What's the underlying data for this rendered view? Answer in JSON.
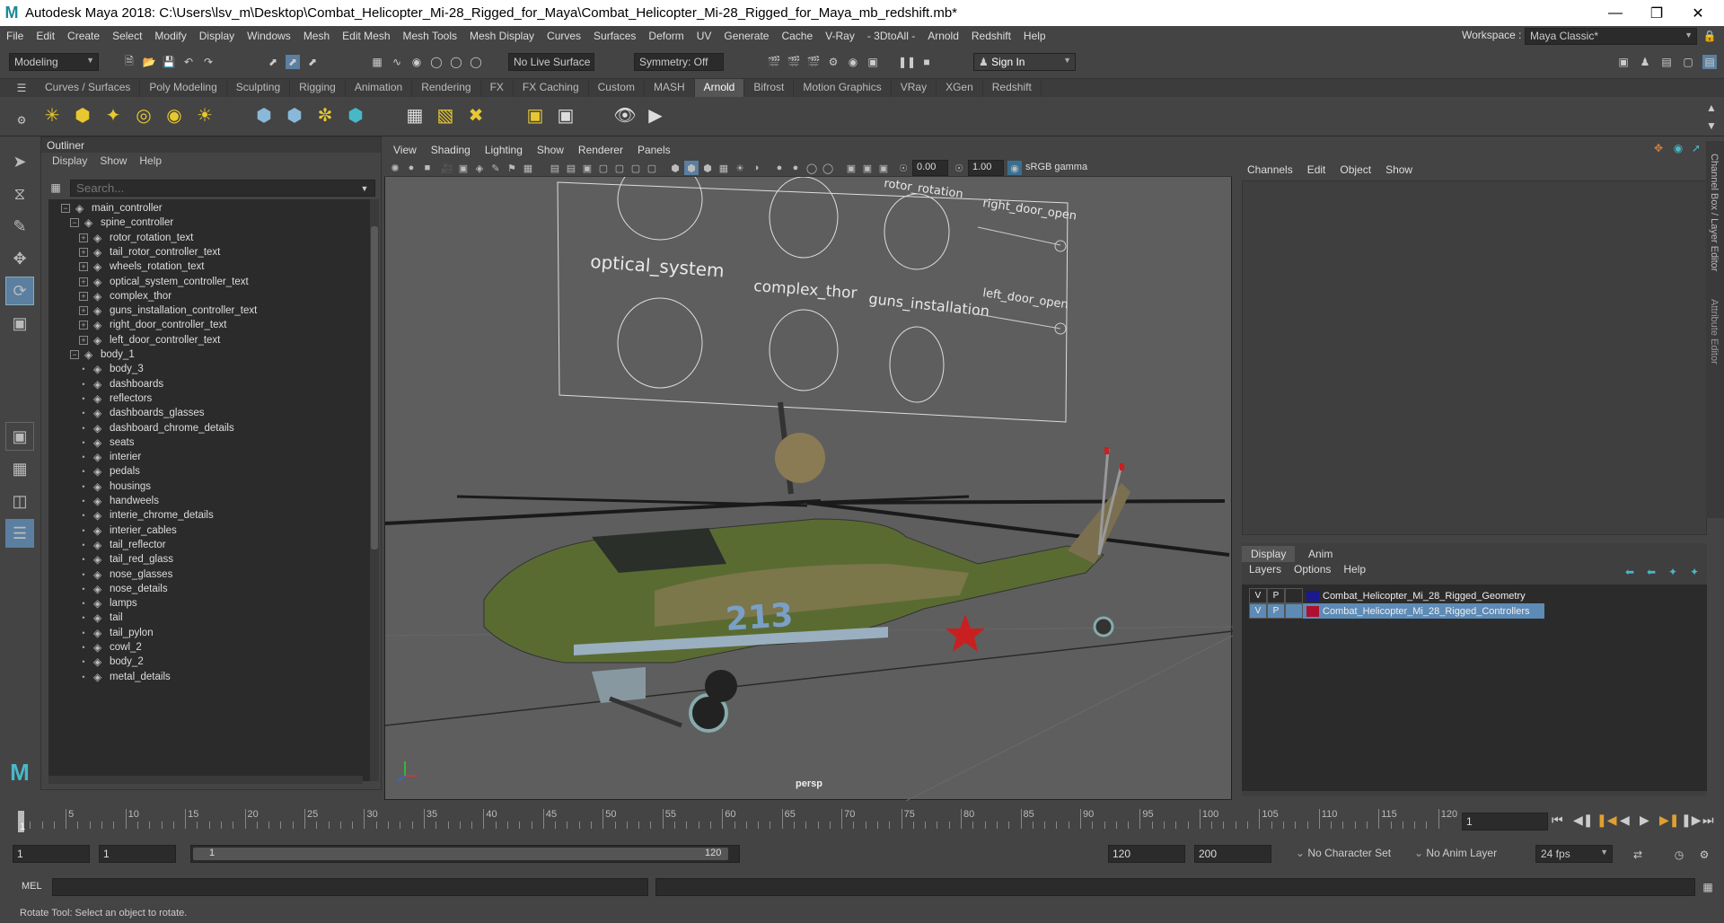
{
  "window": {
    "title": "Autodesk Maya 2018: C:\\Users\\lsv_m\\Desktop\\Combat_Helicopter_Mi-28_Rigged_for_Maya\\Combat_Helicopter_Mi-28_Rigged_for_Maya_mb_redshift.mb*"
  },
  "menubar": [
    "File",
    "Edit",
    "Create",
    "Select",
    "Modify",
    "Display",
    "Windows",
    "Mesh",
    "Edit Mesh",
    "Mesh Tools",
    "Mesh Display",
    "Curves",
    "Surfaces",
    "Deform",
    "UV",
    "Generate",
    "Cache",
    "V-Ray",
    "- 3DtoAll -",
    "Arnold",
    "Redshift",
    "Help"
  ],
  "workspace": {
    "label": "Workspace :",
    "value": "Maya Classic*"
  },
  "statusline": {
    "mode": "Modeling",
    "live_surface": "No Live Surface",
    "symmetry": "Symmetry: Off",
    "sign_in": "Sign In"
  },
  "shelf_tabs": [
    "Curves / Surfaces",
    "Poly Modeling",
    "Sculpting",
    "Rigging",
    "Animation",
    "Rendering",
    "FX",
    "FX Caching",
    "Custom",
    "MASH",
    "Arnold",
    "Bifrost",
    "Motion Graphics",
    "VRay",
    "XGen",
    "Redshift"
  ],
  "shelf_active": "Arnold",
  "outliner": {
    "title": "Outliner",
    "menu": [
      "Display",
      "Show",
      "Help"
    ],
    "search_placeholder": "Search...",
    "items": [
      {
        "label": "main_controller",
        "depth": 0,
        "expander": "minus"
      },
      {
        "label": "spine_controller",
        "depth": 1,
        "expander": "minus"
      },
      {
        "label": "rotor_rotation_text",
        "depth": 2,
        "expander": "plus"
      },
      {
        "label": "tail_rotor_controller_text",
        "depth": 2,
        "expander": "plus"
      },
      {
        "label": "wheels_rotation_text",
        "depth": 2,
        "expander": "plus"
      },
      {
        "label": "optical_system_controller_text",
        "depth": 2,
        "expander": "plus"
      },
      {
        "label": "complex_thor",
        "depth": 2,
        "expander": "plus"
      },
      {
        "label": "guns_installation_controller_text",
        "depth": 2,
        "expander": "plus"
      },
      {
        "label": "right_door_controller_text",
        "depth": 2,
        "expander": "plus"
      },
      {
        "label": "left_door_controller_text",
        "depth": 2,
        "expander": "plus"
      },
      {
        "label": "body_1",
        "depth": 1,
        "expander": "minus"
      },
      {
        "label": "body_3",
        "depth": 2,
        "expander": "dot"
      },
      {
        "label": "dashboards",
        "depth": 2,
        "expander": "dot"
      },
      {
        "label": "reflectors",
        "depth": 2,
        "expander": "dot"
      },
      {
        "label": "dashboards_glasses",
        "depth": 2,
        "expander": "dot"
      },
      {
        "label": "dashboard_chrome_details",
        "depth": 2,
        "expander": "dot"
      },
      {
        "label": "seats",
        "depth": 2,
        "expander": "dot"
      },
      {
        "label": "interier",
        "depth": 2,
        "expander": "dot"
      },
      {
        "label": "pedals",
        "depth": 2,
        "expander": "dot"
      },
      {
        "label": "housings",
        "depth": 2,
        "expander": "dot"
      },
      {
        "label": "handweels",
        "depth": 2,
        "expander": "dot"
      },
      {
        "label": "interie_chrome_details",
        "depth": 2,
        "expander": "dot"
      },
      {
        "label": "interier_cables",
        "depth": 2,
        "expander": "dot"
      },
      {
        "label": "tail_reflector",
        "depth": 2,
        "expander": "dot"
      },
      {
        "label": "tail_red_glass",
        "depth": 2,
        "expander": "dot"
      },
      {
        "label": "nose_glasses",
        "depth": 2,
        "expander": "dot"
      },
      {
        "label": "nose_details",
        "depth": 2,
        "expander": "dot"
      },
      {
        "label": "lamps",
        "depth": 2,
        "expander": "dot"
      },
      {
        "label": "tail",
        "depth": 2,
        "expander": "dot"
      },
      {
        "label": "tail_pylon",
        "depth": 2,
        "expander": "dot"
      },
      {
        "label": "cowl_2",
        "depth": 2,
        "expander": "dot"
      },
      {
        "label": "body_2",
        "depth": 2,
        "expander": "dot"
      },
      {
        "label": "metal_details",
        "depth": 2,
        "expander": "dot"
      }
    ]
  },
  "viewport": {
    "menu": [
      "View",
      "Shading",
      "Lighting",
      "Show",
      "Renderer",
      "Panels"
    ],
    "near_value": "0.00",
    "far_value": "1.00",
    "color_space": "sRGB gamma",
    "camera_label": "persp",
    "board_labels": [
      "optical_system",
      "complex_thor",
      "guns_installation",
      "left_door_open",
      "right_door_open",
      "rotor_rotation"
    ],
    "tail_number": "213",
    "background_color": "#5e5e5e"
  },
  "channel_box": {
    "menu": [
      "Channels",
      "Edit",
      "Object",
      "Show"
    ]
  },
  "layer_editor": {
    "tabs": [
      "Display",
      "Anim"
    ],
    "menu": [
      "Layers",
      "Options",
      "Help"
    ],
    "layers": [
      {
        "v": "V",
        "p": "P",
        "name": "Combat_Helicopter_Mi_28_Rigged_Geometry",
        "color": "#1a1a8c",
        "selected": false
      },
      {
        "v": "V",
        "p": "P",
        "name": "Combat_Helicopter_Mi_28_Rigged_Controllers",
        "color": "#b01030",
        "selected": true
      }
    ]
  },
  "side_tabs": [
    "Channel Box / Layer Editor",
    "Attribute Editor"
  ],
  "timeline": {
    "ticks": [
      "5",
      "10",
      "15",
      "20",
      "25",
      "30",
      "35",
      "40",
      "45",
      "50",
      "55",
      "60",
      "65",
      "70",
      "75",
      "80",
      "85",
      "90",
      "95",
      "100",
      "105",
      "110",
      "115",
      "120"
    ],
    "current_frame_marker": "1",
    "current_frame_field": "1"
  },
  "range": {
    "start": "1",
    "playback_start": "1",
    "slider_start": "1",
    "slider_end": "120",
    "playback_end": "120",
    "end": "200",
    "character_set": "No Character Set",
    "anim_layer": "No Anim Layer",
    "fps": "24 fps"
  },
  "command_line": {
    "label": "MEL"
  },
  "help_line": "Rotate Tool: Select an object to rotate."
}
